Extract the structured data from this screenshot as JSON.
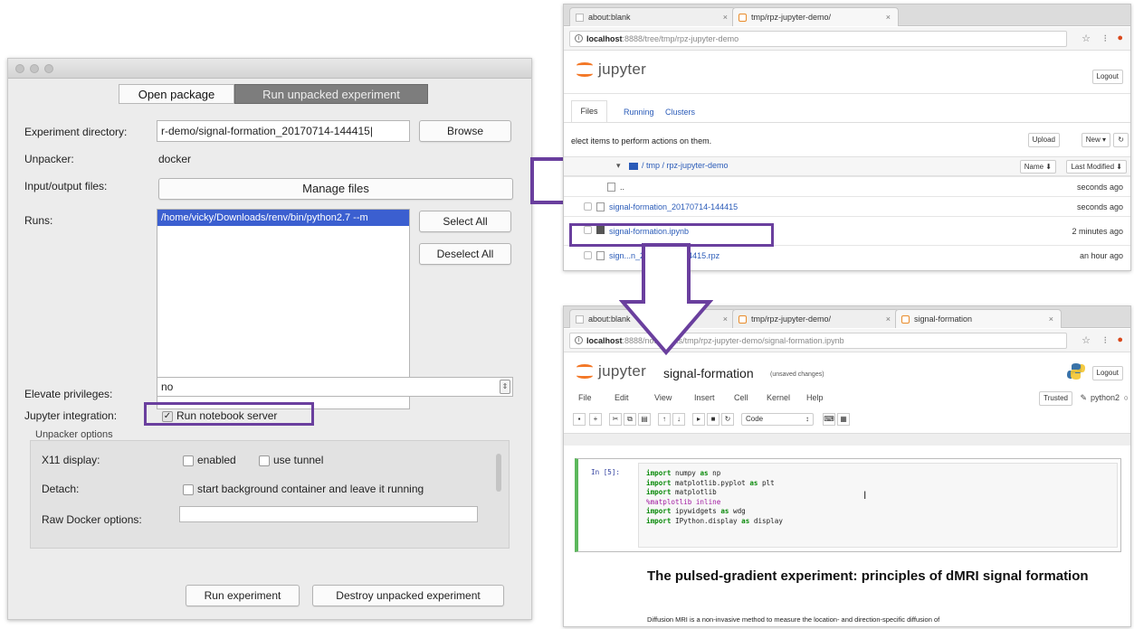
{
  "gui": {
    "tabs": [
      "Open package",
      "Run unpacked experiment"
    ],
    "active_tab": "Run unpacked experiment",
    "labels": {
      "experiment_directory": "Experiment directory:",
      "unpacker": "Unpacker:",
      "input_output_files": "Input/output files:",
      "runs": "Runs:",
      "elevate_privileges": "Elevate privileges:",
      "jupyter_integration": "Jupyter integration:",
      "unpacker_options": "Unpacker options",
      "x11_display": "X11 display:",
      "detach": "Detach:",
      "raw_docker_options": "Raw Docker options:"
    },
    "values": {
      "experiment_directory": "r-demo/signal-formation_20170714-144415|",
      "unpacker": "docker",
      "run_item": "/home/vicky/Downloads/renv/bin/python2.7 --m",
      "elevate_privileges": "no"
    },
    "buttons": {
      "browse": "Browse",
      "manage_files": "Manage files",
      "select_all": "Select All",
      "deselect_all": "Deselect All",
      "run_experiment": "Run experiment",
      "destroy": "Destroy unpacked experiment"
    },
    "checkboxes": {
      "run_notebook_server": "Run notebook server",
      "enabled": "enabled",
      "use_tunnel": "use tunnel",
      "start_background": "start background container and leave it running"
    },
    "highlight_color": "#6a3f9e"
  },
  "browser1": {
    "tabs": [
      "about:blank",
      "tmp/rpz-jupyter-demo/"
    ],
    "url_host": "localhost",
    "url_rest": ":8888/tree/tmp/rpz-jupyter-demo",
    "logo_text": "jupyter",
    "logout": "Logout",
    "nav_tabs": [
      "Files",
      "Running",
      "Clusters"
    ],
    "instruction": "elect items to perform actions on them.",
    "upload": "Upload",
    "new": "New ▾",
    "refresh_icon": "↻",
    "breadcrumb": "/ tmp / rpz-jupyter-demo",
    "sort_name": "Name ⬇",
    "sort_modified": "Last Modified ⬇",
    "rows": [
      {
        "name": "..",
        "time": "seconds ago"
      },
      {
        "name": "signal-formation_20170714-144415",
        "time": "seconds ago"
      },
      {
        "name": "signal-formation.ipynb",
        "time": "2 minutes ago"
      },
      {
        "name": "sign...n_20170714-144415.rpz",
        "time": "an hour ago"
      }
    ]
  },
  "browser2": {
    "tabs": [
      "about:blank",
      "tmp/rpz-jupyter-demo/",
      "signal-formation"
    ],
    "url_host": "localhost",
    "url_rest": ":8888/notebooks/tmp/rpz-jupyter-demo/signal-formation.ipynb",
    "logo_text": "jupyter",
    "notebook_name": "signal-formation",
    "unsaved": "(unsaved changes)",
    "logout": "Logout",
    "menu": [
      "File",
      "Edit",
      "View",
      "Insert",
      "Cell",
      "Kernel",
      "Help"
    ],
    "trusted": "Trusted",
    "kernel": "python2",
    "cell_type": "Code",
    "prompt": "In [5]:",
    "code_lines": [
      {
        "kw": "import",
        "rest": " numpy ",
        "kw2": "as",
        "rest2": " np"
      },
      {
        "kw": "import",
        "rest": " matplotlib.pyplot ",
        "kw2": "as",
        "rest2": " plt"
      },
      {
        "kw": "import",
        "rest": " matplotlib",
        "kw2": "",
        "rest2": ""
      },
      {
        "kw": "",
        "rest": "%matplotlib inline",
        "kw2": "",
        "rest2": ""
      },
      {
        "kw": "import",
        "rest": " ipywidgets ",
        "kw2": "as",
        "rest2": " wdg"
      },
      {
        "kw": "import",
        "rest": " IPython.display ",
        "kw2": "as",
        "rest2": " display"
      }
    ],
    "heading": "The pulsed-gradient experiment: principles of dMRI signal formation",
    "paragraph": "Diffusion MRI is a non-invasive method to measure the location- and direction-specific diffusion of"
  }
}
